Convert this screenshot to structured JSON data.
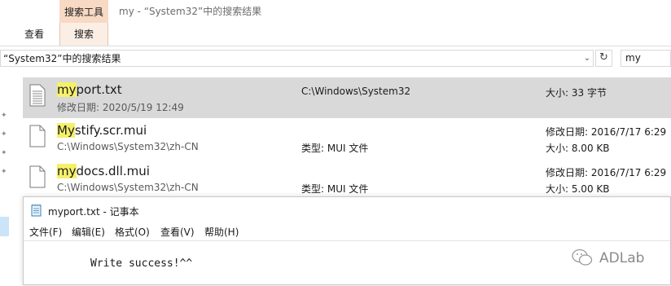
{
  "window": {
    "title": "my - “System32”中的搜索结果",
    "context_tab_header": "搜索工具",
    "tabs": [
      {
        "label": "查看"
      },
      {
        "label": "搜索"
      }
    ]
  },
  "address": {
    "path": "“System32”中的搜索结果",
    "search_value": "my"
  },
  "files": [
    {
      "name_highlight": "my",
      "name_rest": "port.txt",
      "sub": "修改日期: 2020/5/19 12:49",
      "mid": "C:\\Windows\\System32",
      "right_top": "大小: 33 字节",
      "right_bottom": "",
      "icon": "text-file-icon"
    },
    {
      "name_highlight": "My",
      "name_rest": "stify.scr.mui",
      "sub": "C:\\Windows\\System32\\zh-CN",
      "mid": "类型: MUI 文件",
      "right_top": "修改日期: 2016/7/17 6:29",
      "right_bottom": "大小: 8.00 KB",
      "icon": "file-icon"
    },
    {
      "name_highlight": "my",
      "name_rest": "docs.dll.mui",
      "sub": "C:\\Windows\\System32\\zh-CN",
      "mid": "类型: MUI 文件",
      "right_top": "修改日期: 2016/7/17 6:29",
      "right_bottom": "大小: 5.00 KB",
      "icon": "file-icon"
    }
  ],
  "notepad": {
    "title": "myport.txt - 记事本",
    "menu": [
      "文件(F)",
      "编辑(E)",
      "格式(O)",
      "查看(V)",
      "帮助(H)"
    ],
    "content": "Write success!^^"
  },
  "watermark": "ADLab",
  "colors": {
    "context_tab": "#f7d9c4",
    "selection": "#d9d9d9",
    "match_highlight": "#f5f06a"
  }
}
